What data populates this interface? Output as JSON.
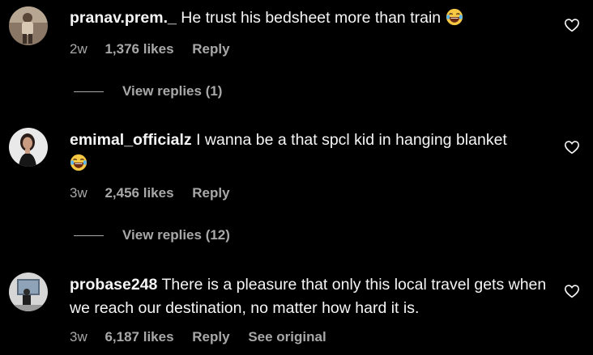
{
  "comments": [
    {
      "username": "pranav.prem._",
      "text": "He trust his bedsheet more than train",
      "time": "2w",
      "likes": "1,376 likes",
      "reply_label": "Reply",
      "avatar_icon": "user-photo",
      "view_replies": "View replies (1)"
    },
    {
      "username": "emimal_officialz",
      "text": "I wanna be a that spcl kid in hanging blanket",
      "time": "3w",
      "likes": "2,456 likes",
      "reply_label": "Reply",
      "avatar_icon": "user-photo",
      "view_replies": "View replies (12)"
    },
    {
      "username": "probase248",
      "text": "There is a pleasure that only this local travel gets when we reach our destination, no matter how hard it is.",
      "time": "3w",
      "likes": "6,187 likes",
      "reply_label": "Reply",
      "see_original_label": "See original",
      "avatar_icon": "user-photo"
    }
  ],
  "icons": {
    "like": "heart-outline-icon",
    "emoji": "rolling-on-floor-laughing-emoji"
  },
  "colors": {
    "background": "#000000",
    "primary_text": "#f5f5f5",
    "secondary_text": "#a8a8a8"
  }
}
